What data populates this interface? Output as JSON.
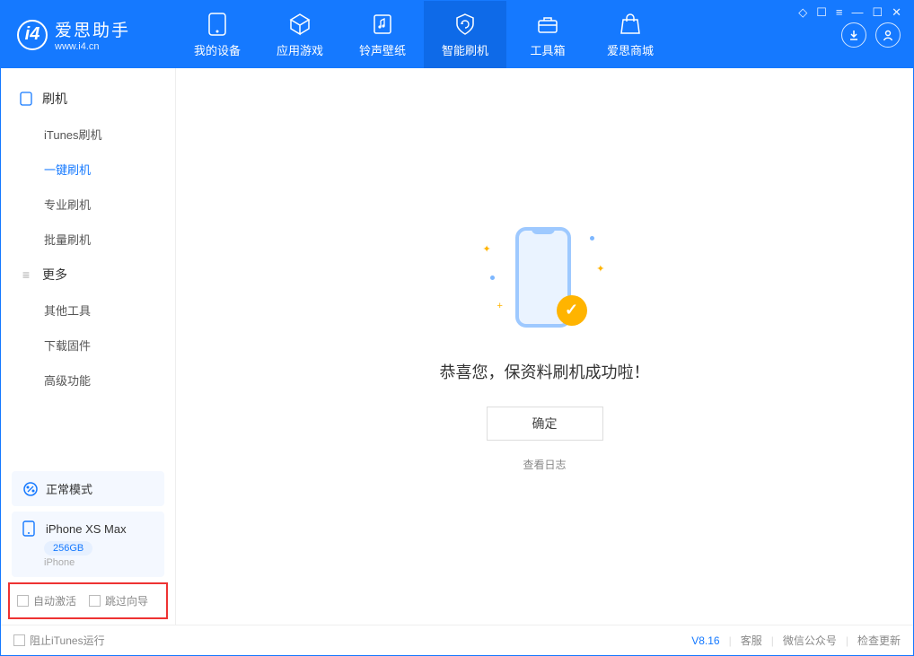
{
  "app": {
    "name": "爱思助手",
    "url": "www.i4.cn"
  },
  "nav": {
    "tabs": [
      {
        "label": "我的设备"
      },
      {
        "label": "应用游戏"
      },
      {
        "label": "铃声壁纸"
      },
      {
        "label": "智能刷机"
      },
      {
        "label": "工具箱"
      },
      {
        "label": "爱思商城"
      }
    ]
  },
  "sidebar": {
    "group1": {
      "header": "刷机",
      "items": [
        "iTunes刷机",
        "一键刷机",
        "专业刷机",
        "批量刷机"
      ]
    },
    "group2": {
      "header": "更多",
      "items": [
        "其他工具",
        "下载固件",
        "高级功能"
      ]
    }
  },
  "mode_card": {
    "label": "正常模式"
  },
  "device_card": {
    "name": "iPhone XS Max",
    "storage": "256GB",
    "type": "iPhone"
  },
  "options": {
    "auto_activate": "自动激活",
    "skip_guide": "跳过向导"
  },
  "main": {
    "success_msg": "恭喜您，保资料刷机成功啦！",
    "ok_button": "确定",
    "view_log": "查看日志"
  },
  "footer": {
    "block_itunes": "阻止iTunes运行",
    "version": "V8.16",
    "links": [
      "客服",
      "微信公众号",
      "检查更新"
    ]
  }
}
